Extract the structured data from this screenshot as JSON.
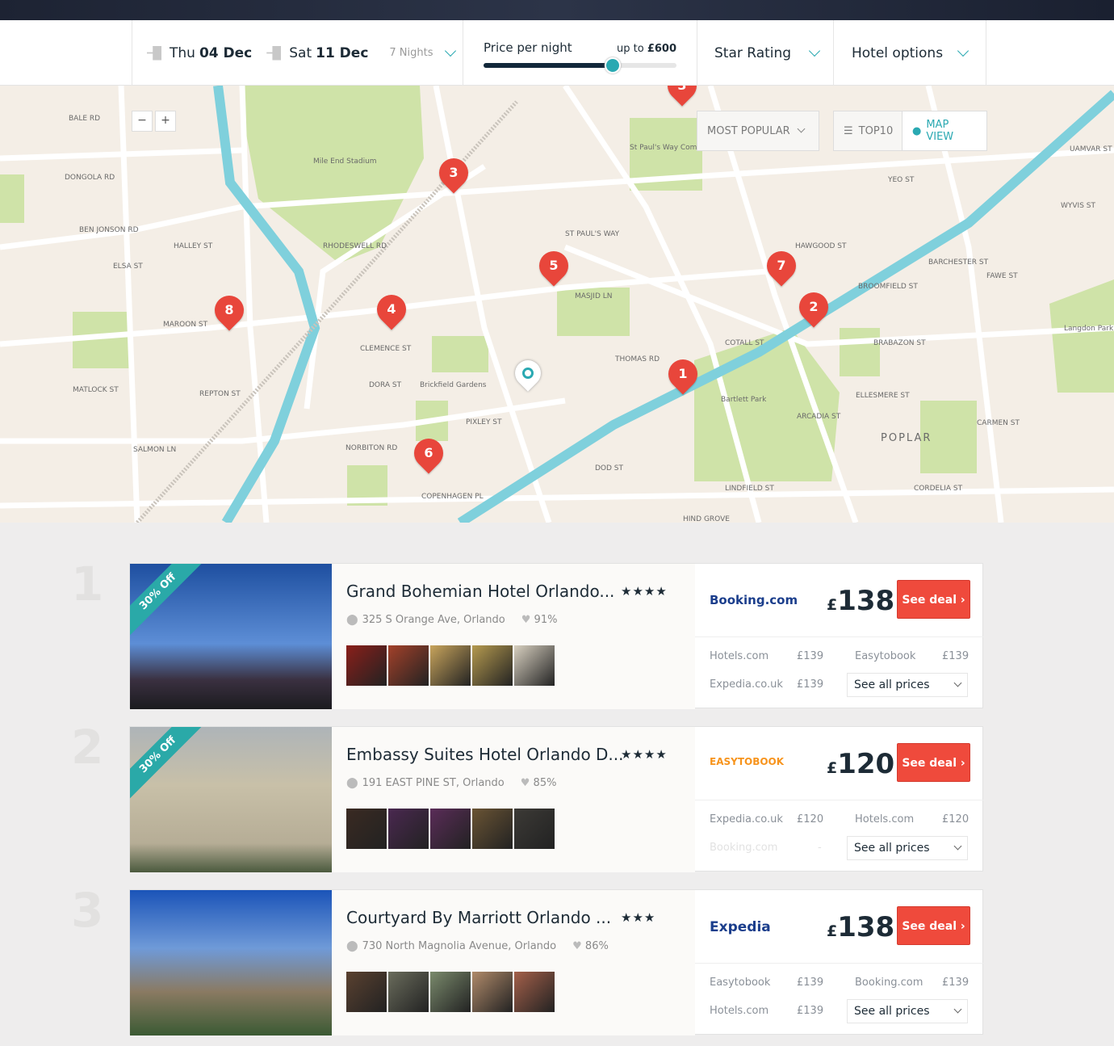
{
  "filters": {
    "checkin_day": "Thu",
    "checkin_date": "04 Dec",
    "checkout_day": "Sat",
    "checkout_date": "11 Dec",
    "nights": "7 Nights",
    "price_label": "Price per night",
    "price_max_prefix": "up to",
    "price_max": "£600",
    "price_slider_percent": 67,
    "star_rating": "Star Rating",
    "hotel_options": "Hotel options"
  },
  "map": {
    "zoom_out": "−",
    "zoom_in": "+",
    "sort": "MOST POPULAR",
    "top10": "TOP10",
    "map_view": "MAP VIEW",
    "accent": "#2aa9b2",
    "pin_color": "#e8463b",
    "pins": [
      "1",
      "2",
      "3",
      "4",
      "5",
      "6",
      "7",
      "8",
      "3"
    ],
    "labels": [
      "BALE RD",
      "DONGOLA RD",
      "BEN JONSON RD",
      "HALLEY ST",
      "ELSA ST",
      "MAROON ST",
      "MATLOCK ST",
      "REPTON ST",
      "SALMON LN",
      "RHODESWELL RD",
      "CLEMENCE ST",
      "DORA ST",
      "NORBITON RD",
      "COPENHAGEN PL",
      "PIXLEY ST",
      "ST PAUL'S WAY",
      "MASJID LN",
      "THOMAS RD",
      "DOD ST",
      "COTALL ST",
      "HAWGOOD ST",
      "BROOMFIELD ST",
      "BARCHESTER ST",
      "FAWE ST",
      "BRABAZON ST",
      "ELLESMERE ST",
      "ARCADIA ST",
      "POPLAR",
      "CARMEN ST",
      "CORDELIA ST",
      "LINDFIELD ST",
      "HIND GROVE",
      "Mile End Stadium",
      "St Paul's Way Community School",
      "Brickfield Gardens",
      "Bartlett Park",
      "Langdon Park",
      "YEO ST",
      "UAMVAR ST",
      "WYVIS ST"
    ]
  },
  "hotels": [
    {
      "rank": "1",
      "discount": "30% Off",
      "name": "Grand Bohemian Hotel Orlando...",
      "stars": "★★★★",
      "address": "325 S Orange Ave, Orlando",
      "rating": "91%",
      "provider": "Booking.com",
      "currency": "£",
      "price": "138",
      "deal": "See deal",
      "others": [
        {
          "name": "Hotels.com",
          "price": "£139"
        },
        {
          "name": "Easytobook",
          "price": "£139"
        },
        {
          "name": "Expedia.co.uk",
          "price": "£139"
        }
      ],
      "see_all": "See all prices"
    },
    {
      "rank": "2",
      "discount": "30% Off",
      "name": "Embassy Suites Hotel Orlando D...",
      "stars": "★★★★",
      "address": "191 EAST PINE ST, Orlando",
      "rating": "85%",
      "provider": "EASYTOBOOK",
      "currency": "£",
      "price": "120",
      "deal": "See deal",
      "others": [
        {
          "name": "Expedia.co.uk",
          "price": "£120"
        },
        {
          "name": "Hotels.com",
          "price": "£120"
        },
        {
          "name": "Booking.com",
          "price": "-"
        }
      ],
      "see_all": "See all prices"
    },
    {
      "rank": "3",
      "discount": "",
      "name": "Courtyard By Marriott Orlando ...",
      "stars": "★★★",
      "address": "730 North Magnolia Avenue, Orlando",
      "rating": "86%",
      "provider": "Expedia",
      "currency": "£",
      "price": "138",
      "deal": "See deal",
      "others": [
        {
          "name": "Easytobook",
          "price": "£139"
        },
        {
          "name": "Booking.com",
          "price": "£139"
        },
        {
          "name": "Hotels.com",
          "price": "£139"
        }
      ],
      "see_all": "See all prices"
    }
  ]
}
